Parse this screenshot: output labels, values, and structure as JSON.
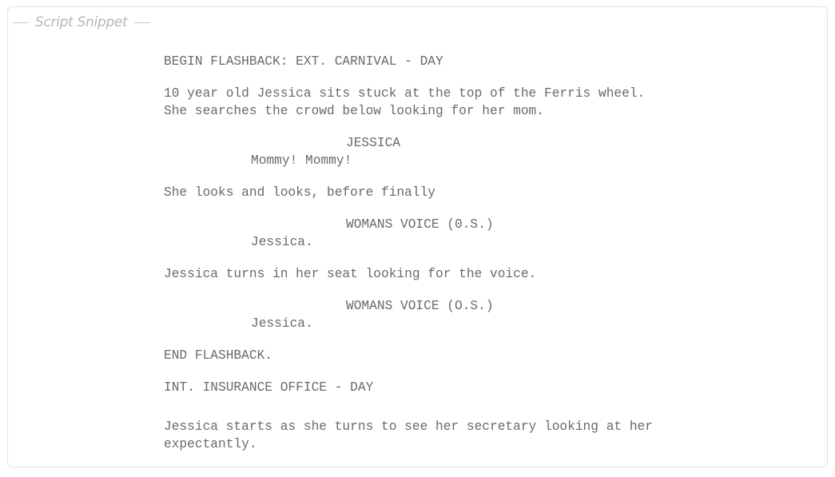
{
  "panel": {
    "title": "Script Snippet"
  },
  "script": {
    "slug1": "BEGIN FLASHBACK: EXT. CARNIVAL - DAY",
    "action1_line1": "10 year old Jessica sits stuck at the top of the Ferris wheel.",
    "action1_line2": "She searches the crowd below looking for her mom.",
    "char1": "JESSICA",
    "dialog1": "Mommy! Mommy!",
    "action2": "She looks and looks, before finally",
    "char2": "WOMANS VOICE (0.S.)",
    "dialog2": "Jessica.",
    "action3": "Jessica turns in her seat looking for the voice.",
    "char3": "WOMANS VOICE (O.S.)",
    "dialog3": "Jessica.",
    "transition": "END FLASHBACK.",
    "slug2": "INT. INSURANCE OFFICE - DAY",
    "action4_line1": "Jessica starts as she turns to see her secretary looking at her",
    "action4_line2": "expectantly."
  }
}
